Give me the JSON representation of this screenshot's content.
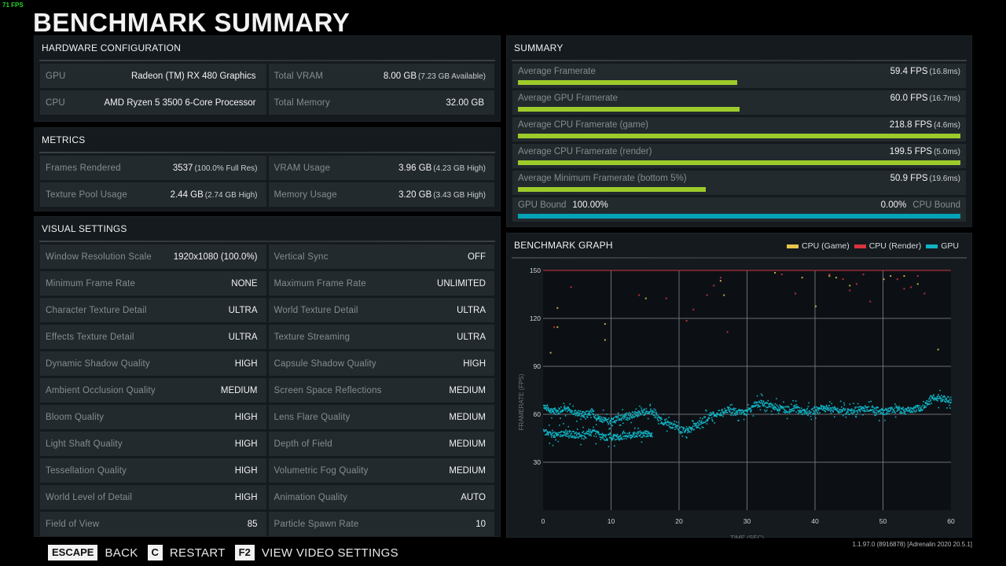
{
  "overlay": {
    "fps_counter": "71 FPS"
  },
  "page": {
    "title": "BENCHMARK SUMMARY"
  },
  "hardware": {
    "title": "HARDWARE CONFIGURATION",
    "items": [
      {
        "label": "GPU",
        "value": "Radeon (TM) RX 480 Graphics",
        "sub": ""
      },
      {
        "label": "Total VRAM",
        "value": "8.00 GB",
        "sub": "(7.23 GB Available)"
      },
      {
        "label": "CPU",
        "value": "AMD Ryzen 5 3500 6-Core Processor",
        "sub": ""
      },
      {
        "label": "Total Memory",
        "value": "32.00 GB",
        "sub": ""
      }
    ]
  },
  "metrics": {
    "title": "METRICS",
    "items": [
      {
        "label": "Frames Rendered",
        "value": "3537",
        "sub": "(100.0% Full Res)"
      },
      {
        "label": "VRAM Usage",
        "value": "3.96 GB",
        "sub": "(4.23 GB High)"
      },
      {
        "label": "Texture Pool Usage",
        "value": "2.44 GB",
        "sub": "(2.74 GB High)"
      },
      {
        "label": "Memory Usage",
        "value": "3.20 GB",
        "sub": "(3.43 GB High)"
      }
    ]
  },
  "visual_settings": {
    "title": "VISUAL SETTINGS",
    "items": [
      {
        "label": "Window Resolution Scale",
        "value": "1920x1080 (100.0%)"
      },
      {
        "label": "Vertical Sync",
        "value": "OFF"
      },
      {
        "label": "Minimum Frame Rate",
        "value": "NONE"
      },
      {
        "label": "Maximum Frame Rate",
        "value": "UNLIMITED"
      },
      {
        "label": "Character Texture Detail",
        "value": "ULTRA"
      },
      {
        "label": "World Texture Detail",
        "value": "ULTRA"
      },
      {
        "label": "Effects Texture Detail",
        "value": "ULTRA"
      },
      {
        "label": "Texture Streaming",
        "value": "ULTRA"
      },
      {
        "label": "Dynamic Shadow Quality",
        "value": "HIGH"
      },
      {
        "label": "Capsule Shadow Quality",
        "value": "HIGH"
      },
      {
        "label": "Ambient Occlusion Quality",
        "value": "MEDIUM"
      },
      {
        "label": "Screen Space Reflections",
        "value": "MEDIUM"
      },
      {
        "label": "Bloom Quality",
        "value": "HIGH"
      },
      {
        "label": "Lens Flare Quality",
        "value": "MEDIUM"
      },
      {
        "label": "Light Shaft Quality",
        "value": "HIGH"
      },
      {
        "label": "Depth of Field",
        "value": "MEDIUM"
      },
      {
        "label": "Tessellation Quality",
        "value": "HIGH"
      },
      {
        "label": "Volumetric Fog Quality",
        "value": "MEDIUM"
      },
      {
        "label": "World Level of Detail",
        "value": "HIGH"
      },
      {
        "label": "Animation Quality",
        "value": "AUTO"
      },
      {
        "label": "Field of View",
        "value": "85"
      },
      {
        "label": "Particle Spawn Rate",
        "value": "10"
      }
    ]
  },
  "summary": {
    "title": "SUMMARY",
    "bar_scale_max_fps": 120,
    "rows": [
      {
        "label": "Average Framerate",
        "value": "59.4 FPS",
        "sub": "(16.8ms)",
        "fps": 59.4
      },
      {
        "label": "Average GPU Framerate",
        "value": "60.0 FPS",
        "sub": "(16.7ms)",
        "fps": 60.0
      },
      {
        "label": "Average CPU Framerate (game)",
        "value": "218.8 FPS",
        "sub": "(4.6ms)",
        "fps": 218.8
      },
      {
        "label": "Average CPU Framerate (render)",
        "value": "199.5 FPS",
        "sub": "(5.0ms)",
        "fps": 199.5
      },
      {
        "label": "Average Minimum Framerate (bottom 5%)",
        "value": "50.9 FPS",
        "sub": "(19.6ms)",
        "fps": 50.9
      }
    ],
    "bound": {
      "gpu_label": "GPU Bound",
      "gpu_value": "100.00%",
      "cpu_label": "CPU Bound",
      "cpu_value": "0.00%",
      "gpu_fraction": 1.0
    }
  },
  "colors": {
    "bar_green": "#9dcb2c",
    "bar_cyan": "#05a3b8",
    "cpu_game": "#e8c44a",
    "cpu_render": "#d8343f",
    "gpu": "#0fb3c4"
  },
  "graph": {
    "title": "BENCHMARK GRAPH",
    "legend": [
      {
        "name": "CPU (Game)",
        "color": "#e8c44a"
      },
      {
        "name": "CPU (Render)",
        "color": "#d8343f"
      },
      {
        "name": "GPU",
        "color": "#0fb3c4"
      }
    ]
  },
  "chart_data": {
    "type": "scatter",
    "title": "BENCHMARK GRAPH",
    "xlabel": "TIME (SEC)",
    "ylabel": "FRAMERATE (FPS)",
    "xlim": [
      0,
      60
    ],
    "ylim": [
      0,
      150
    ],
    "xticks": [
      0,
      10,
      20,
      30,
      40,
      50,
      60
    ],
    "yticks": [
      30,
      60,
      90,
      120,
      150
    ],
    "grid": true,
    "legend_position": "top-right",
    "series": [
      {
        "name": "GPU",
        "color": "#0fb3c4",
        "x": [
          0,
          1,
          2,
          3,
          4,
          5,
          6,
          7,
          8,
          9,
          10,
          11,
          12,
          13,
          14,
          15,
          16,
          17,
          18,
          19,
          20,
          21,
          22,
          23,
          24,
          25,
          26,
          27,
          28,
          29,
          30,
          31,
          32,
          33,
          34,
          35,
          36,
          37,
          38,
          39,
          40,
          41,
          42,
          43,
          44,
          45,
          46,
          47,
          48,
          49,
          50,
          51,
          52,
          53,
          54,
          55,
          56,
          57,
          58,
          59,
          60
        ],
        "y": [
          66,
          63,
          62,
          65,
          62,
          61,
          60,
          62,
          58,
          57,
          56,
          58,
          59,
          60,
          61,
          62,
          62,
          57,
          55,
          53,
          51,
          50,
          52,
          55,
          58,
          60,
          61,
          63,
          63,
          61,
          62,
          66,
          67,
          66,
          65,
          64,
          63,
          65,
          62,
          61,
          63,
          64,
          64,
          63,
          63,
          62,
          63,
          64,
          64,
          63,
          62,
          63,
          64,
          62,
          63,
          64,
          65,
          71,
          70,
          70,
          69
        ]
      },
      {
        "name": "GPU (secondary band)",
        "color": "#0fb3c4",
        "x": [
          0,
          1,
          2,
          3,
          4,
          5,
          6,
          7,
          8,
          9,
          10,
          11,
          12,
          13,
          14,
          15,
          16
        ],
        "y": [
          49,
          48,
          47,
          49,
          48,
          47,
          47,
          49,
          48,
          46,
          46,
          46,
          47,
          47,
          48,
          48,
          48
        ]
      },
      {
        "name": "CPU (Render)",
        "color": "#d8343f",
        "x": [
          1.5,
          4,
          14,
          18,
          21,
          22,
          24,
          25,
          26,
          27,
          35,
          37,
          42,
          44,
          45,
          46,
          47,
          48,
          52,
          53,
          54,
          55,
          56
        ],
        "y": [
          115,
          140,
          135,
          133,
          119,
          126,
          135,
          141,
          146,
          112,
          148,
          136,
          148,
          145,
          138,
          142,
          148,
          131,
          145,
          139,
          140,
          147,
          136
        ]
      },
      {
        "name": "CPU (Game)",
        "color": "#e8c44a",
        "x": [
          1,
          2,
          2,
          9,
          9,
          15,
          26,
          26.5,
          34,
          38,
          40,
          42,
          43,
          45,
          50,
          51,
          53,
          55,
          58
        ],
        "y": [
          99,
          127,
          115,
          107,
          117,
          133,
          144,
          135,
          149,
          146,
          128,
          147,
          146,
          141,
          145,
          147,
          147,
          142,
          101
        ]
      }
    ]
  },
  "footer": {
    "actions": [
      {
        "key": "ESCAPE",
        "label": "BACK"
      },
      {
        "key": "C",
        "label": "RESTART"
      },
      {
        "key": "F2",
        "label": "VIEW VIDEO SETTINGS"
      }
    ],
    "version": "1.1.97.0 (8916878) [Adrenalin 2020 20.5.1]"
  }
}
